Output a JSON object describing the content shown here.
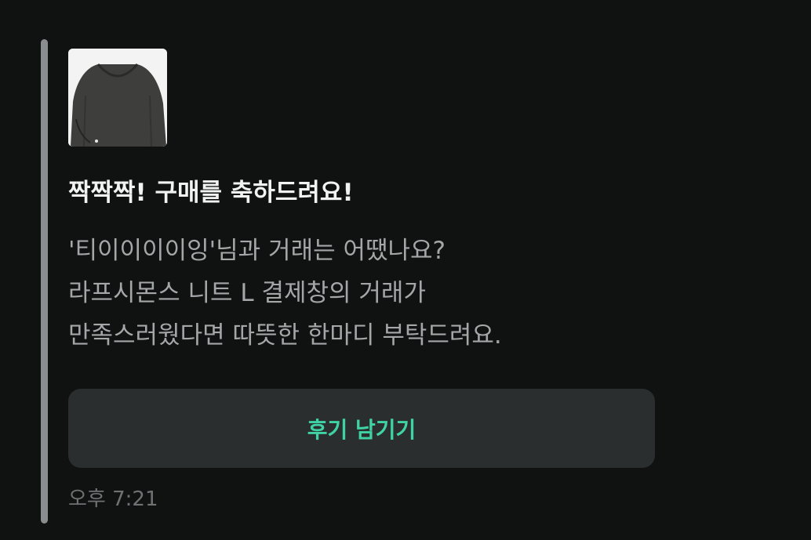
{
  "message": {
    "title": "짝짝짝! 구매를 축하드려요!",
    "body_lines": [
      "'티이이이이잉'님과 거래는 어땠나요?",
      "라프시몬스 니트 L 결제창의 거래가",
      "만족스러웠다면 따뜻한 한마디 부탁드려요."
    ],
    "button_label": "후기 남기기",
    "timestamp": "오후 7:21",
    "product_image_icon": "sweater-photo"
  },
  "colors": {
    "background": "#101212",
    "accent_bar": "#8a8d8d",
    "title": "#f2f2f2",
    "body": "#a4a7a8",
    "button_bg": "#2b2e2e",
    "button_text": "#3fd2a5",
    "timestamp": "#6e7273"
  }
}
